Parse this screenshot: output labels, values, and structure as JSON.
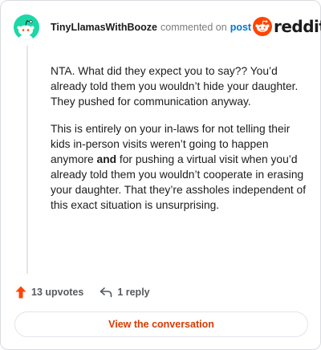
{
  "comment": {
    "author": "TinyLlamasWithBooze",
    "action_text": "commented on",
    "post_link": "post",
    "brand": "reddit",
    "paragraph1": "NTA. What did they expect you to say?? You’d already told them you wouldn’t hide your daughter. They pushed for communication anyway.",
    "paragraph2_before": "This is entirely on your in-laws for not telling their kids in-person visits weren’t going to happen anymore ",
    "paragraph2_bold": "and",
    "paragraph2_after": " for pushing a virtual visit when you’d already told them you wouldn’t cooperate in erasing your daughter. That they’re assholes independent of this exact situation is unsurprising."
  },
  "footer": {
    "upvotes_label": "13 upvotes",
    "replies_label": "1 reply",
    "view_button_label": "View the conversation"
  },
  "icons": {
    "avatar": "snoo-avatar-icon",
    "brand": "reddit-logo-icon",
    "upvote": "upvote-arrow-icon",
    "reply": "reply-arrow-icon"
  },
  "colors": {
    "avatar_bg": "#1dd7a7",
    "reddit_orange": "#ff4500",
    "link_blue": "#0079d3",
    "button_text": "#d93a00"
  }
}
